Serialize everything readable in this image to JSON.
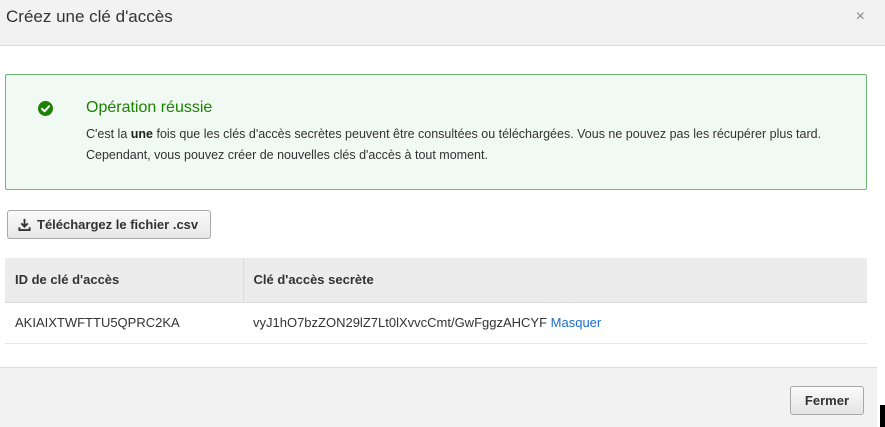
{
  "dialog": {
    "title": "Créez une clé d'accès",
    "close_glyph": "×"
  },
  "alert": {
    "status": "success",
    "icon": "check-circle-icon",
    "title": "Opération réussie",
    "text_before": "C'est la ",
    "text_bold": "une",
    "text_after": " fois que les clés d'accès secrètes peuvent être consultées ou téléchargées. Vous ne pouvez pas les récupérer plus tard. Cependant, vous pouvez créer de nouvelles clés d'accès à tout moment."
  },
  "download_button": {
    "icon": "download-icon",
    "label": "Téléchargez le fichier .csv"
  },
  "table": {
    "headers": [
      "ID de clé d'accès",
      "Clé d'accès secrète"
    ],
    "rows": [
      {
        "access_key_id": "AKIAIXTWFTTU5QPRC2KA",
        "secret_access_key": "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",
        "toggle_label": "Masquer"
      }
    ]
  },
  "footer": {
    "close_label": "Fermer"
  },
  "colors": {
    "success_green": "#1d8102",
    "success_border": "#6cb877",
    "success_bg": "#f0f9f2",
    "link_blue": "#1a6fcb"
  }
}
